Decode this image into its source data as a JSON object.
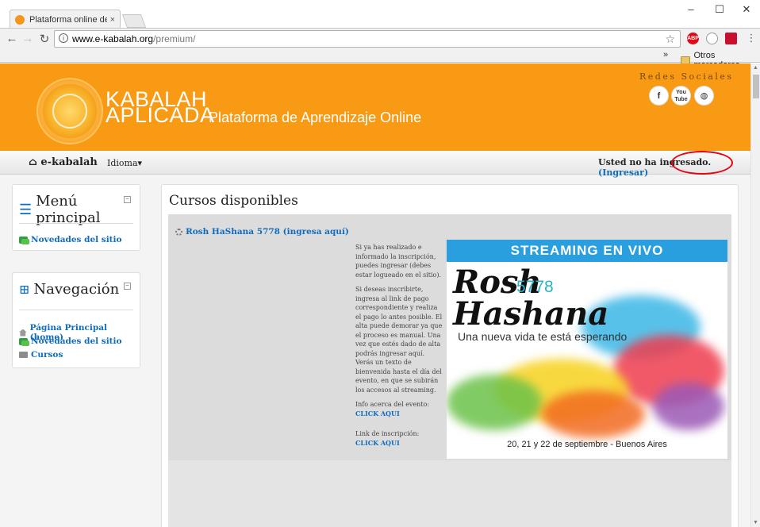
{
  "browser": {
    "tab_title": "Plataforma online de ens",
    "tab_close": "×",
    "url_host": "www.e-kabalah.org",
    "url_path": "/premium/",
    "bookmarks_more": "»",
    "bookmarks_folder": "Otros marcadores",
    "window_controls": [
      "–",
      "☐",
      "✕"
    ],
    "extensions": [
      {
        "name": "adblock-icon",
        "label": "ABP",
        "color": "#e30613"
      },
      {
        "name": "history-icon",
        "label": "",
        "color": "#9a9a9a"
      },
      {
        "name": "pdf-icon",
        "label": "",
        "color": "#c8102e"
      }
    ]
  },
  "banner": {
    "brand_line1": "KABALAH",
    "brand_line2": "APLICADA",
    "subtitle": "Plataforma de Aprendizaje Online",
    "social_title": "Redes Sociales",
    "social": [
      {
        "name": "facebook-icon",
        "glyph": "f"
      },
      {
        "name": "youtube-icon",
        "glyph": "You\nTube"
      },
      {
        "name": "globe-icon",
        "glyph": "◍"
      }
    ]
  },
  "navbar": {
    "home_label": "e-kabalah",
    "language_label": "Idioma",
    "login_prefix": "Usted no ha ingresado. ",
    "login_link": "(Ingresar)"
  },
  "sidebar": {
    "main_menu": {
      "title": "Menú principal",
      "items": [
        {
          "label": "Novedades del sitio"
        }
      ]
    },
    "navigation": {
      "title": "Navegación",
      "items": [
        {
          "label": "Página Principal (home)"
        },
        {
          "label": "Novedades del sitio"
        },
        {
          "label": "Cursos"
        }
      ]
    }
  },
  "main": {
    "heading": "Cursos disponibles",
    "course": {
      "title": "Rosh HaShana 5778 (ingresa aquí)",
      "paragraph1": "Si ya has realizado e informado la inscripción, puedes ingresar (debes estar logueado en el sitio).",
      "paragraph2": "Si deseas inscribirte, ingresa al link de pago correspondiente y realiza el pago lo antes posible. El alta puede demorar ya que el proceso es manual. Una vez que estés dado de alta podrás ingresar aquí. Verás un texto de bienvenida hasta el día del evento, en que se subirán los accesos al streaming.",
      "info_label": "Info acerca del evento:",
      "info_link": "CLICK AQUI",
      "signup_label": "Link de inscripción:",
      "signup_link": "CLICK AQUI"
    },
    "poster": {
      "band": "STREAMING EN VIVO",
      "rosh": "Rosh",
      "number": "5778",
      "hashana": "Hashana",
      "tagline": "Una nueva vida te está esperando",
      "date": "20, 21 y 22 de septiembre - Buenos Aires"
    }
  }
}
